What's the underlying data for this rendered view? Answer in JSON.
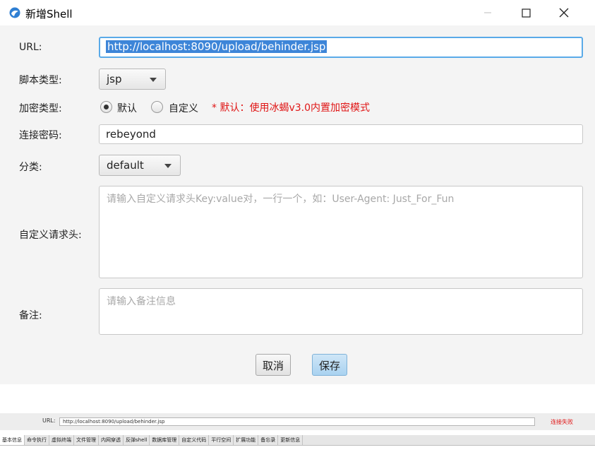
{
  "window": {
    "title": "新增Shell"
  },
  "form": {
    "url_label": "URL:",
    "url_value": "http://localhost:8090/upload/behinder.jsp",
    "script_type_label": "脚本类型:",
    "script_type_value": "jsp",
    "encrypt_type_label": "加密类型:",
    "encrypt_options": [
      {
        "label": "默认",
        "selected": true
      },
      {
        "label": "自定义",
        "selected": false
      }
    ],
    "encrypt_hint": "* 默认：使用冰蝎v3.0内置加密模式",
    "password_label": "连接密码:",
    "password_value": "rebeyond",
    "category_label": "分类:",
    "category_value": "default",
    "headers_label": "自定义请求头:",
    "headers_placeholder": "请输入自定义请求头Key:value对，一行一个，如：User-Agent: Just_For_Fun",
    "notes_label": "备注:",
    "notes_placeholder": "请输入备注信息",
    "cancel_label": "取消",
    "save_label": "保存"
  },
  "bottom_panel": {
    "url_label": "URL:",
    "url_value": "http://localhost:8090/upload/behinder.jsp",
    "status": "连接失败",
    "tabs": [
      "基本信息",
      "命令执行",
      "虚拟终端",
      "文件管理",
      "内网穿透",
      "反弹shell",
      "数据库管理",
      "自定义代码",
      "平行空间",
      "扩展功能",
      "备忘录",
      "更新信息"
    ],
    "active_tab": "基本信息"
  },
  "colors": {
    "accent": "#3d85d8",
    "focus_border": "#5aaae8",
    "error": "#e01515",
    "save_button": "#a9d2f0"
  }
}
